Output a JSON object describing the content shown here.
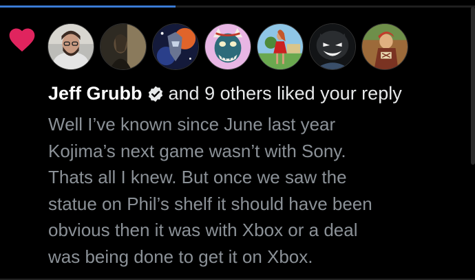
{
  "progress": {
    "fraction": 0.37,
    "color": "#3a7bd5"
  },
  "notification": {
    "type": "like",
    "icon": "heart-icon",
    "icon_color": "#e0245e",
    "avatars": [
      {
        "name": "avatar-bearded-man-glasses"
      },
      {
        "name": "avatar-dark-figure"
      },
      {
        "name": "avatar-space-armor"
      },
      {
        "name": "avatar-oni-mask"
      },
      {
        "name": "avatar-red-dress-woman"
      },
      {
        "name": "avatar-grinning-shadow"
      },
      {
        "name": "avatar-comic-character"
      }
    ],
    "user_name": "Jeff Grubb",
    "verified_icon": "verified-badge-icon",
    "action_text": "and 9 others liked your reply",
    "reply_lines": [
      "Well I’ve known since June last year",
      "Kojima’s next game wasn’t with Sony.",
      "Thats all I knew. But once we saw the",
      "statue on Phil’s shelf it should have been",
      "obvious then it was with Xbox or a deal",
      "was being done to get it on Xbox."
    ]
  },
  "colors": {
    "background": "#000000",
    "name_text": "#ffffff",
    "body_text": "#8b9197"
  }
}
